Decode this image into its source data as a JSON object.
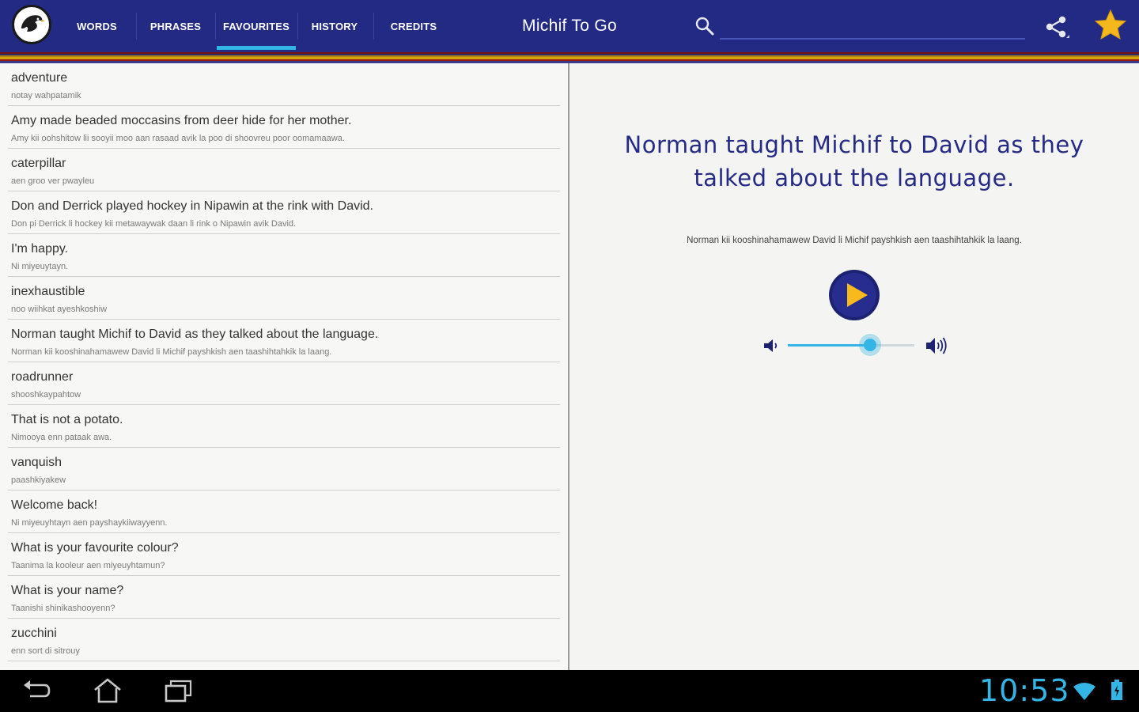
{
  "app": {
    "title": "Michif To Go"
  },
  "tabs": [
    {
      "label": "WORDS",
      "selected": false
    },
    {
      "label": "PHRASES",
      "selected": false
    },
    {
      "label": "FAVOURITES",
      "selected": true
    },
    {
      "label": "HISTORY",
      "selected": false
    },
    {
      "label": "CREDITS",
      "selected": false
    }
  ],
  "search": {
    "value": "",
    "placeholder": ""
  },
  "favourites": [
    {
      "english": "adventure",
      "michif": "notay wahpatamik"
    },
    {
      "english": "Amy made beaded moccasins from deer hide for her mother.",
      "michif": "Amy kii oohshitow lii sooyii moo aan rasaad avik la poo di shoovreu poor oomamaawa."
    },
    {
      "english": "caterpillar",
      "michif": "aen groo ver pwayleu"
    },
    {
      "english": "Don and Derrick played hockey in Nipawin at the rink with David.",
      "michif": "Don pi Derrick li hockey kii metawaywak daan li rink o Nipawin avik David."
    },
    {
      "english": "I'm happy.",
      "michif": "Ni miyeuytayn."
    },
    {
      "english": "inexhaustible",
      "michif": "noo wiihkat ayeshkoshiw"
    },
    {
      "english": "Norman taught Michif to David as they talked about the language.",
      "michif": "Norman kii kooshinahamawew David li Michif payshkish aen taashihtahkik la laang."
    },
    {
      "english": "roadrunner",
      "michif": "shooshkaypahtow"
    },
    {
      "english": "That is not a potato.",
      "michif": "Nimooya enn pataak awa."
    },
    {
      "english": "vanquish",
      "michif": "paashkiyakew"
    },
    {
      "english": "Welcome back!",
      "michif": "Ni miyeuyhtayn aen payshaykiiwayyenn."
    },
    {
      "english": "What is your favourite colour?",
      "michif": "Taanima la kooleur aen miyeuyhtamun?"
    },
    {
      "english": "What is your name?",
      "michif": "Taanishi shinikashooyenn?"
    },
    {
      "english": "zucchini",
      "michif": "enn sort di sitrouy"
    }
  ],
  "detail": {
    "english": "Norman taught Michif to David as they talked about the language.",
    "michif": "Norman kii kooshinahamawew David li Michif payshkish aen taashihtahkik la laang.",
    "volume": 0.65
  },
  "system": {
    "time": "10:53"
  },
  "colors": {
    "actionbar": "#232a84",
    "accent": "#33b5e5",
    "phrase_text": "#252a86",
    "star": "#f5b81c"
  },
  "icons": {
    "logo": "eagle-logo-icon",
    "search": "search-icon",
    "share": "share-icon",
    "favourite": "star-icon",
    "play": "play-icon",
    "volume_low": "volume-low-icon",
    "volume_high": "volume-high-icon",
    "back": "back-icon",
    "home": "home-icon",
    "recents": "recent-apps-icon",
    "wifi": "wifi-icon",
    "battery": "battery-icon"
  }
}
